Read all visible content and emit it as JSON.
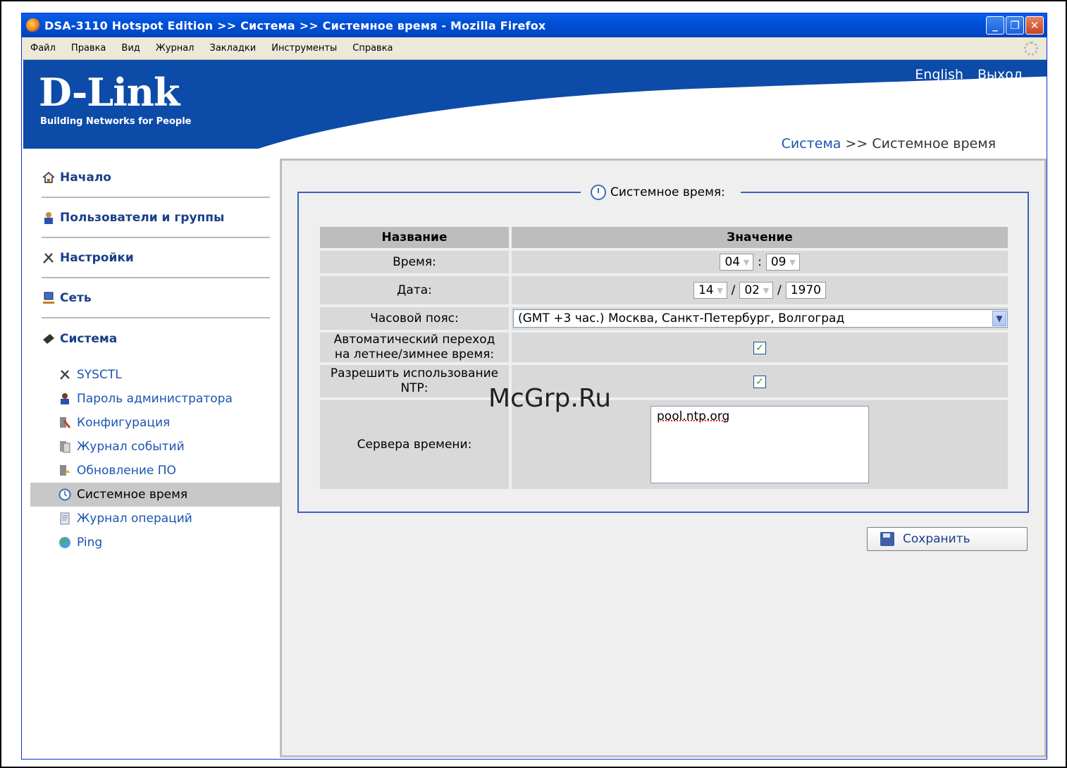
{
  "window": {
    "title": "DSA-3110 Hotspot Edition >> Система >> Системное время - Mozilla Firefox",
    "buttons": [
      "_",
      "❐",
      "✕"
    ]
  },
  "menu": [
    "Файл",
    "Правка",
    "Вид",
    "Журнал",
    "Закладки",
    "Инструменты",
    "Справка"
  ],
  "header": {
    "logo": "D-Link",
    "tagline": "Building Networks for People",
    "links": [
      "English",
      "Выход"
    ]
  },
  "breadcrumb": {
    "section": "Система",
    "sep": " >> ",
    "page": "Системное время"
  },
  "nav": {
    "sections": [
      {
        "label": "Начало",
        "icon": "home-icon"
      },
      {
        "label": "Пользователи и группы",
        "icon": "users-icon"
      },
      {
        "label": "Настройки",
        "icon": "tools-icon"
      },
      {
        "label": "Сеть",
        "icon": "network-icon"
      },
      {
        "label": "Система",
        "icon": "system-icon"
      }
    ],
    "items": [
      {
        "label": "SYSCTL",
        "icon": "wrench-icon"
      },
      {
        "label": "Пароль администратора",
        "icon": "admin-user-icon"
      },
      {
        "label": "Конфигурация",
        "icon": "config-icon"
      },
      {
        "label": "Журнал событий",
        "icon": "event-log-icon"
      },
      {
        "label": "Обновление ПО",
        "icon": "firmware-update-icon"
      },
      {
        "label": "Системное время",
        "icon": "clock-icon"
      },
      {
        "label": "Журнал операций",
        "icon": "operations-log-icon"
      },
      {
        "label": "Ping",
        "icon": "ping-icon"
      }
    ]
  },
  "panel": {
    "legend": "Системное время:",
    "col_name": "Название",
    "col_value": "Значение",
    "time_label": "Время:",
    "time_hours": "04",
    "time_sep": ":",
    "time_minutes": "09",
    "date_label": "Дата:",
    "date_day": "14",
    "date_sep": "/",
    "date_month": "02",
    "date_year": "1970",
    "tz_label": "Часовой пояс:",
    "tz_value": "(GMT +3 час.) Москва, Санкт-Петербург, Волгоград",
    "dst_label_1": "Автоматический переход",
    "dst_label_2": "на летнее/зимнее время:",
    "dst_checked": true,
    "ntp_label_1": "Разрешить использование",
    "ntp_label_2": "NTP:",
    "ntp_checked": true,
    "servers_label": "Сервера времени:",
    "servers_value": "pool.ntp.org",
    "save_label": "Сохранить"
  },
  "watermark": "McGrp.Ru"
}
